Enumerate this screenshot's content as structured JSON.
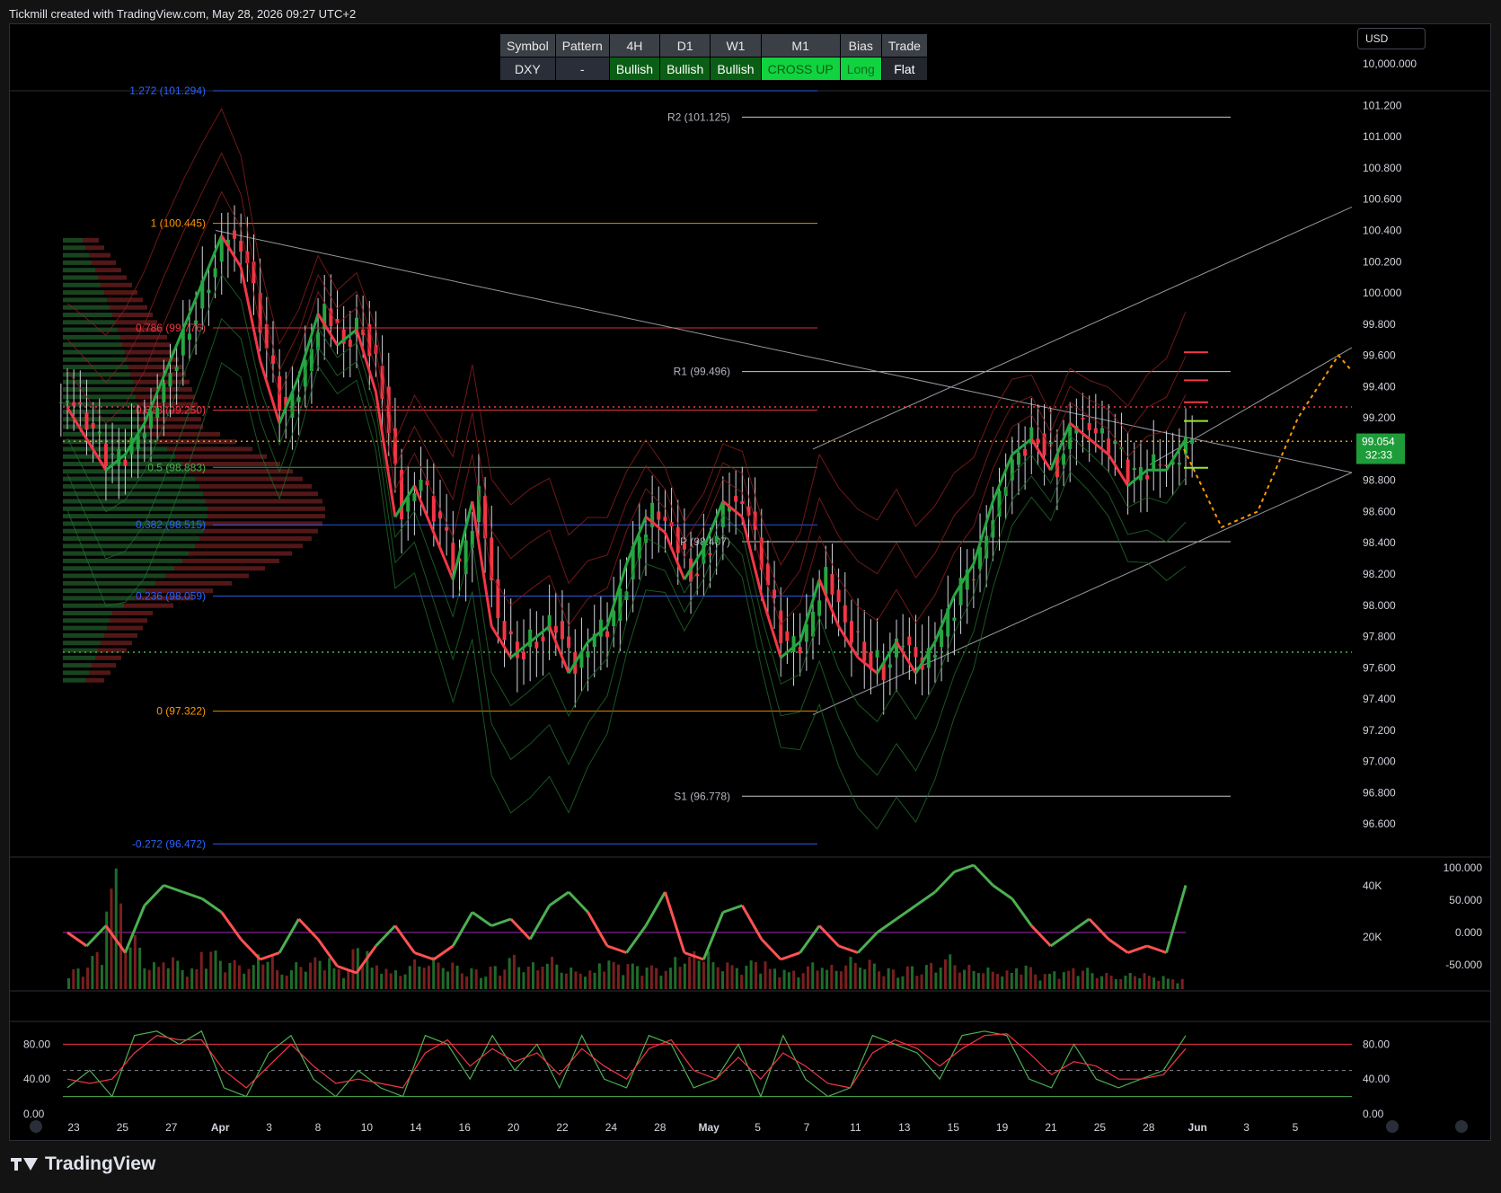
{
  "header": {
    "title": "Tickmill created with TradingView.com, May 28, 2026 09:27 UTC+2"
  },
  "footer": {
    "brand": "TradingView"
  },
  "signal_table": {
    "headers": [
      "Symbol",
      "Pattern",
      "4H",
      "D1",
      "W1",
      "M1",
      "Bias",
      "Trade"
    ],
    "values": [
      "DXY",
      "-",
      "Bullish",
      "Bullish",
      "Bullish",
      "CROSS UP",
      "Long",
      "Flat"
    ]
  },
  "currency": "USD",
  "top_value": "10,000.000",
  "price_tag": {
    "value": "99.054",
    "countdown": "32:33",
    "color": "#1e9c3a"
  },
  "chart_data": [
    {
      "type": "candlestick",
      "ylim": [
        96.4,
        101.3
      ],
      "y_ticks": [
        "101.200",
        "101.000",
        "100.800",
        "100.600",
        "100.400",
        "100.200",
        "100.000",
        "99.800",
        "99.600",
        "99.400",
        "99.200",
        "99.000",
        "98.800",
        "98.600",
        "98.400",
        "98.200",
        "98.000",
        "97.800",
        "97.600",
        "97.400",
        "97.200",
        "97.000",
        "96.800",
        "96.600"
      ],
      "x_ticks": [
        "23",
        "25",
        "27",
        "Apr",
        "3",
        "8",
        "10",
        "14",
        "16",
        "20",
        "22",
        "24",
        "28",
        "May",
        "5",
        "7",
        "11",
        "13",
        "15",
        "19",
        "21",
        "25",
        "28",
        "Jun",
        "3",
        "5"
      ],
      "x_tick_bold": [
        "Apr",
        "May",
        "Jun"
      ],
      "close_series": [
        99.3,
        99.1,
        98.9,
        99.0,
        99.2,
        99.5,
        99.8,
        100.1,
        100.4,
        100.2,
        99.6,
        99.2,
        99.5,
        99.9,
        99.7,
        99.8,
        99.4,
        98.6,
        98.8,
        98.5,
        98.2,
        98.7,
        97.9,
        97.7,
        97.8,
        97.9,
        97.6,
        97.8,
        97.9,
        98.3,
        98.6,
        98.5,
        98.2,
        98.4,
        98.7,
        98.6,
        98.1,
        97.7,
        97.8,
        98.2,
        97.9,
        97.7,
        97.6,
        97.8,
        97.6,
        97.8,
        98.1,
        98.3,
        98.7,
        99.0,
        99.1,
        98.9,
        99.2,
        99.1,
        99.0,
        98.8,
        98.9,
        98.9,
        99.1
      ],
      "fibonacci": [
        {
          "label": "1.272 (101.294)",
          "value": 101.294,
          "color": "#2962ff"
        },
        {
          "label": "1 (100.445)",
          "value": 100.445,
          "color": "#ff9800"
        },
        {
          "label": "0.786 (99.776)",
          "value": 99.776,
          "color": "#f23645"
        },
        {
          "label": "0.618 (99.250)",
          "value": 99.25,
          "color": "#f23645"
        },
        {
          "label": "0.5 (98.883)",
          "value": 98.883,
          "color": "#4caf50"
        },
        {
          "label": "0.382 (98.515)",
          "value": 98.515,
          "color": "#2962ff"
        },
        {
          "label": "0.236 (98.059)",
          "value": 98.059,
          "color": "#2962ff"
        },
        {
          "label": "0 (97.322)",
          "value": 97.322,
          "color": "#ff9800"
        },
        {
          "label": "-0.272 (96.472)",
          "value": 96.472,
          "color": "#2962ff"
        }
      ],
      "pivots": [
        {
          "label": "R2 (101.125)",
          "value": 101.125
        },
        {
          "label": "R1 (99.496)",
          "value": 99.496
        },
        {
          "label": "P (98.407)",
          "value": 98.407
        },
        {
          "label": "S1 (96.778)",
          "value": 96.778
        }
      ],
      "reference_lines": [
        {
          "value": 99.27,
          "color": "#f23645",
          "style": "dotted"
        },
        {
          "value": 99.05,
          "color": "#ff9800",
          "style": "dotted"
        },
        {
          "value": 97.7,
          "color": "#4caf50",
          "style": "dotted"
        }
      ],
      "projection": {
        "color": "#ff9800",
        "path": [
          99.0,
          98.5,
          98.6,
          99.2,
          99.6,
          99.5
        ]
      }
    },
    {
      "type": "line+bar",
      "y_ticks_left": [
        "40K",
        "20K"
      ],
      "y_ticks_right": [
        "100.000",
        "50.000",
        "0.000",
        "-50.000"
      ],
      "oscillator": [
        0,
        -20,
        10,
        -30,
        40,
        70,
        60,
        50,
        30,
        -10,
        -40,
        -30,
        20,
        -10,
        -50,
        -60,
        -20,
        10,
        -30,
        -40,
        -20,
        30,
        10,
        20,
        -10,
        40,
        60,
        30,
        -20,
        -30,
        10,
        60,
        -30,
        -40,
        30,
        40,
        -10,
        -40,
        -30,
        10,
        -20,
        -30,
        0,
        20,
        40,
        60,
        90,
        100,
        70,
        50,
        10,
        -20,
        0,
        20,
        -10,
        -30,
        -20,
        -30,
        70
      ],
      "volume": [
        8,
        14,
        45,
        20,
        10,
        12,
        8,
        15,
        11,
        9,
        13,
        7,
        10,
        12,
        8,
        16,
        9,
        7,
        11,
        12,
        10,
        8,
        9,
        13,
        10,
        12,
        8,
        7,
        11,
        10,
        9,
        8,
        12,
        14,
        10,
        9,
        11,
        8,
        7,
        10,
        9,
        12,
        11,
        8,
        9,
        10,
        13,
        9,
        8,
        7,
        9,
        6,
        7,
        8,
        6,
        5,
        6,
        5,
        4
      ]
    },
    {
      "type": "line",
      "y_ticks": [
        "80.00",
        "40.00",
        "0.00"
      ],
      "bands": [
        80,
        50,
        20
      ],
      "k_series": [
        30,
        50,
        20,
        90,
        95,
        80,
        95,
        30,
        20,
        70,
        90,
        40,
        20,
        50,
        30,
        20,
        90,
        80,
        40,
        90,
        50,
        80,
        30,
        90,
        40,
        30,
        90,
        80,
        30,
        40,
        80,
        20,
        90,
        40,
        20,
        30,
        90,
        80,
        70,
        40,
        90,
        95,
        90,
        40,
        30,
        80,
        40,
        30,
        40,
        50,
        90
      ],
      "d_series": [
        40,
        35,
        40,
        70,
        90,
        85,
        85,
        50,
        30,
        55,
        80,
        55,
        35,
        40,
        35,
        30,
        70,
        85,
        55,
        75,
        60,
        70,
        45,
        75,
        55,
        40,
        75,
        85,
        50,
        40,
        65,
        40,
        70,
        55,
        35,
        30,
        70,
        85,
        75,
        55,
        75,
        90,
        92,
        70,
        45,
        60,
        55,
        40,
        40,
        45,
        75
      ]
    }
  ]
}
